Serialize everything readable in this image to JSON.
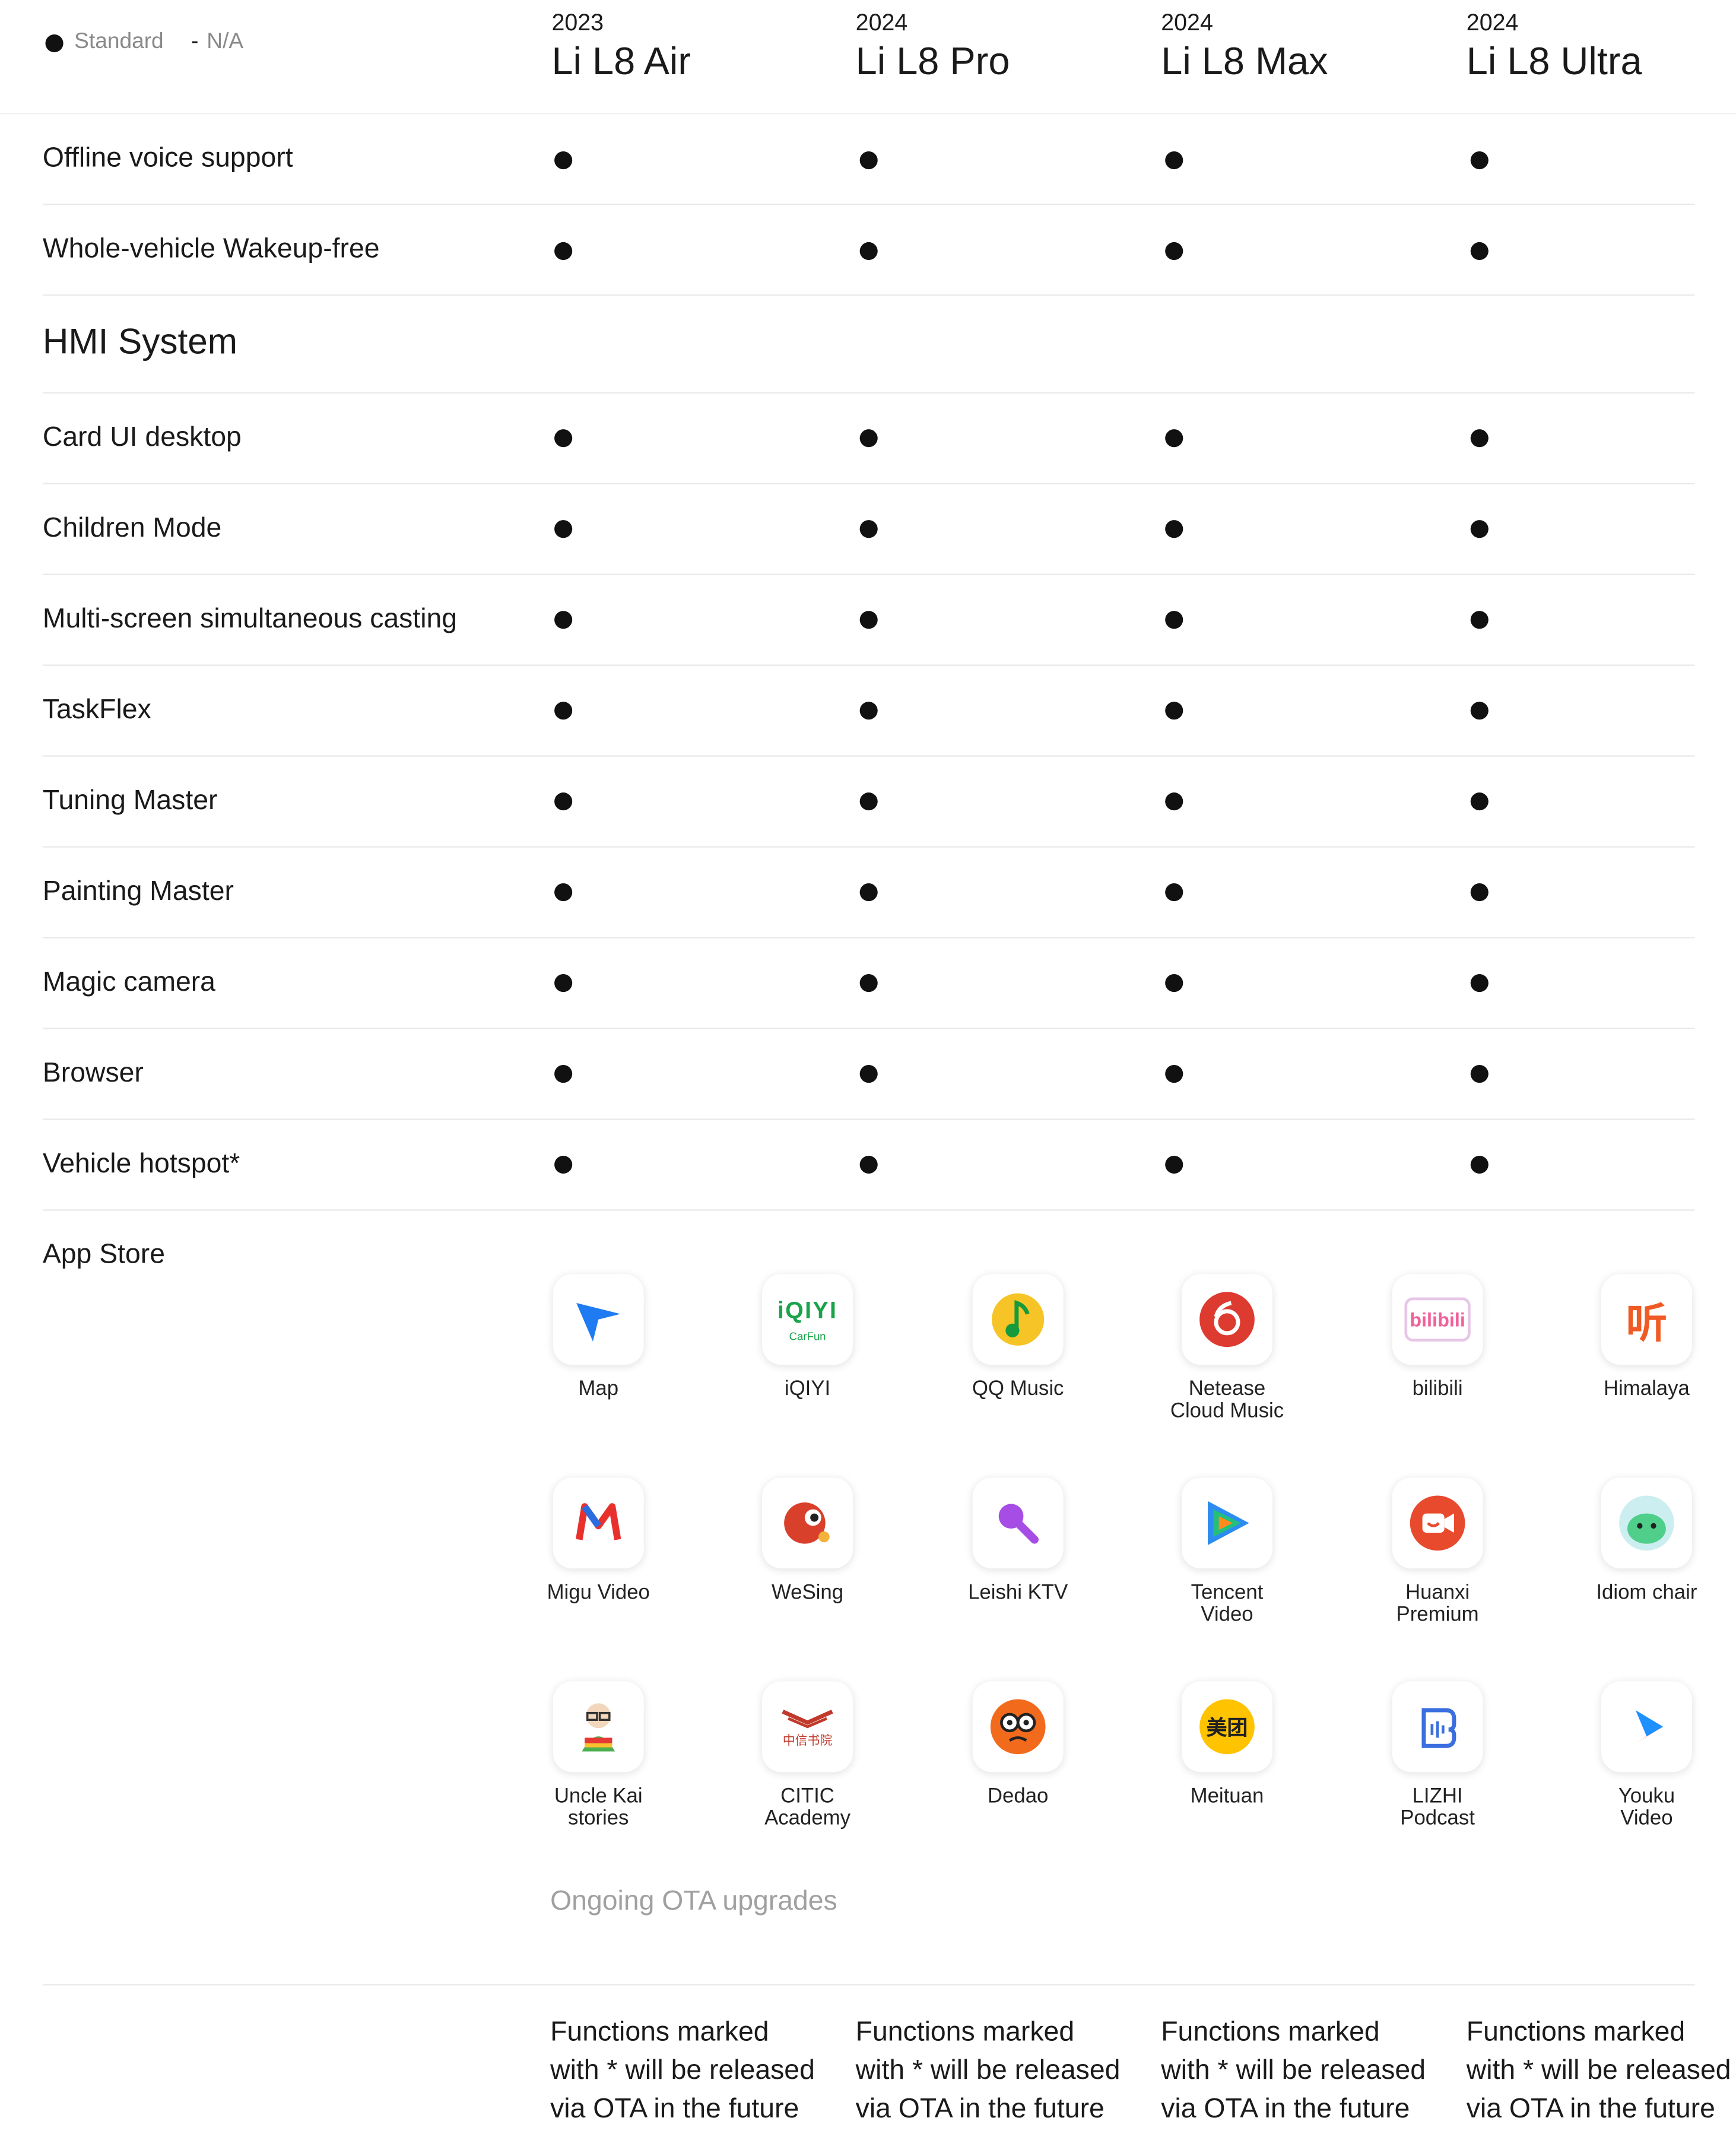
{
  "legend": {
    "standard": "Standard",
    "na": "N/A"
  },
  "models": [
    {
      "year": "2023",
      "name": "Li L8 Air"
    },
    {
      "year": "2024",
      "name": "Li L8 Pro"
    },
    {
      "year": "2024",
      "name": "Li L8 Max"
    },
    {
      "year": "2024",
      "name": "Li L8 Ultra"
    }
  ],
  "rows_top": [
    {
      "label": "Offline voice support",
      "values": [
        "Standard",
        "Standard",
        "Standard",
        "Standard"
      ]
    },
    {
      "label": "Whole-vehicle Wakeup-free",
      "values": [
        "Standard",
        "Standard",
        "Standard",
        "Standard"
      ]
    }
  ],
  "section_title": "HMI System",
  "rows_hmi": [
    {
      "label": "Card UI desktop",
      "values": [
        "Standard",
        "Standard",
        "Standard",
        "Standard"
      ]
    },
    {
      "label": "Children Mode",
      "values": [
        "Standard",
        "Standard",
        "Standard",
        "Standard"
      ]
    },
    {
      "label": "Multi-screen simultaneous casting",
      "values": [
        "Standard",
        "Standard",
        "Standard",
        "Standard"
      ]
    },
    {
      "label": "TaskFlex",
      "values": [
        "Standard",
        "Standard",
        "Standard",
        "Standard"
      ]
    },
    {
      "label": "Tuning Master",
      "values": [
        "Standard",
        "Standard",
        "Standard",
        "Standard"
      ]
    },
    {
      "label": "Painting Master",
      "values": [
        "Standard",
        "Standard",
        "Standard",
        "Standard"
      ]
    },
    {
      "label": "Magic camera",
      "values": [
        "Standard",
        "Standard",
        "Standard",
        "Standard"
      ]
    },
    {
      "label": "Browser",
      "values": [
        "Standard",
        "Standard",
        "Standard",
        "Standard"
      ]
    },
    {
      "label": "Vehicle hotspot*",
      "values": [
        "Standard",
        "Standard",
        "Standard",
        "Standard"
      ]
    }
  ],
  "app_store": {
    "label": "App Store",
    "apps": [
      {
        "name": "Map",
        "icon": "map-arrow-icon"
      },
      {
        "name": "iQIYI",
        "icon": "iqiyi-icon",
        "icon_text": "iQIYI",
        "icon_subtext": "CarFun"
      },
      {
        "name": "QQ Music",
        "icon": "qq-music-icon"
      },
      {
        "name": "Netease\nCloud Music",
        "icon": "netease-icon"
      },
      {
        "name": "bilibili",
        "icon": "bilibili-icon",
        "icon_text": "bilibili"
      },
      {
        "name": "Himalaya",
        "icon": "himalaya-icon",
        "icon_text": "听"
      },
      {
        "name": "Migu Video",
        "icon": "migu-icon"
      },
      {
        "name": "WeSing",
        "icon": "wesing-icon"
      },
      {
        "name": "Leishi KTV",
        "icon": "leishi-ktv-icon"
      },
      {
        "name": "Tencent\nVideo",
        "icon": "tencent-video-icon"
      },
      {
        "name": "Huanxi\nPremium",
        "icon": "huanxi-icon"
      },
      {
        "name": "Idiom chair",
        "icon": "idiom-chair-icon"
      },
      {
        "name": "Uncle Kai\nstories",
        "icon": "uncle-kai-icon"
      },
      {
        "name": "CITIC\nAcademy",
        "icon": "citic-icon",
        "icon_text": "中信书院"
      },
      {
        "name": "Dedao",
        "icon": "dedao-icon"
      },
      {
        "name": "Meituan",
        "icon": "meituan-icon",
        "icon_text": "美团"
      },
      {
        "name": "LIZHI\nPodcast",
        "icon": "lizhi-icon"
      },
      {
        "name": "Youku\nVideo",
        "icon": "youku-icon"
      }
    ],
    "ota_note": "Ongoing OTA upgrades"
  },
  "footnote": "Functions marked with * will be released via OTA in the future"
}
